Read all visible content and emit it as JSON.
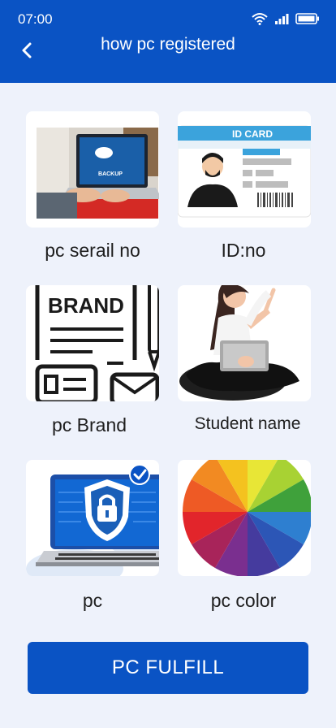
{
  "status_bar": {
    "time": "07:00"
  },
  "header": {
    "title": "how pc registered"
  },
  "options": [
    {
      "label": "pc serail no"
    },
    {
      "label": "ID:no",
      "card_text": "ID CARD"
    },
    {
      "label": "pc Brand",
      "card_text": "BRAND"
    },
    {
      "label": "Student name"
    },
    {
      "label": "pc",
      "selected": true
    },
    {
      "label": "pc color"
    }
  ],
  "laptop_screen_text": "BACKUP",
  "action_button": {
    "label": "PC FULFILL"
  },
  "colors": {
    "primary": "#0a53c4",
    "background": "#eef2fb"
  }
}
